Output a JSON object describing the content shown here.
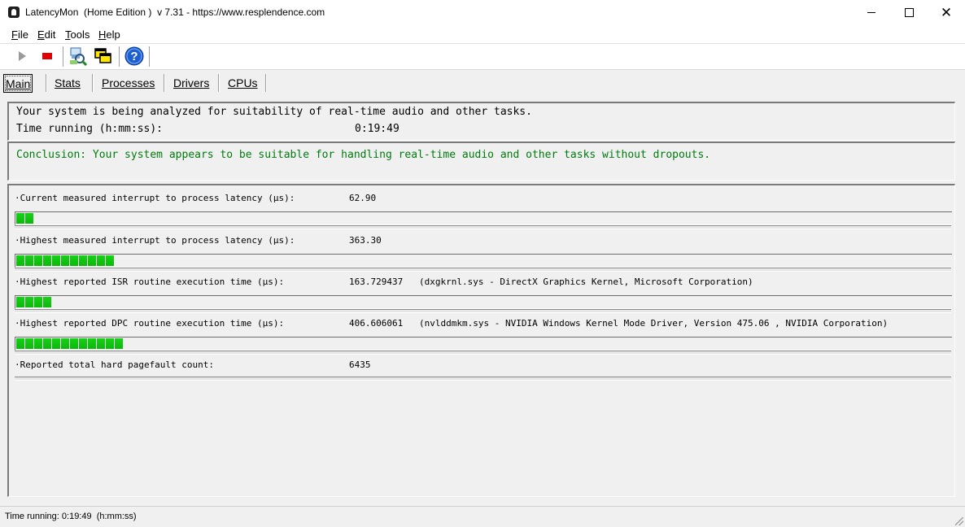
{
  "window": {
    "title": "LatencyMon  (Home Edition )  v 7.31 - https://www.resplendence.com"
  },
  "menu": {
    "items": [
      {
        "key": "F",
        "rest": "ile"
      },
      {
        "key": "E",
        "rest": "dit"
      },
      {
        "key": "T",
        "rest": "ools"
      },
      {
        "key": "H",
        "rest": "elp"
      }
    ]
  },
  "toolbar": {
    "icons": [
      "play-icon",
      "stop-icon",
      "analyze-icon",
      "windows-icon",
      "help-icon"
    ],
    "colors": {
      "play": "#9a9a9a",
      "stop": "#e00000",
      "help": "#1e5fd0"
    }
  },
  "tabs": [
    {
      "label": "Main",
      "active": true
    },
    {
      "label": "Stats",
      "active": false
    },
    {
      "label": "Processes",
      "active": false
    },
    {
      "label": "Drivers",
      "active": false
    },
    {
      "label": "CPUs",
      "active": false
    }
  ],
  "analysis": {
    "line1": "Your system is being analyzed for suitability of real-time audio and other tasks.",
    "time_label": "Time running (h:mm:ss):",
    "time_value": "0:19:49"
  },
  "conclusion": {
    "text": "Conclusion: Your system appears to be suitable for handling real-time audio and other tasks without dropouts.",
    "color": "#007a0e"
  },
  "metrics": [
    {
      "label": "·Current measured interrupt to process latency (µs):",
      "value": "62.90",
      "detail": "",
      "meter_fraction": 0.021
    },
    {
      "label": "·Highest measured interrupt to process latency (µs):",
      "value": "363.30",
      "detail": "",
      "meter_fraction": 0.103
    },
    {
      "label": "·Highest reported ISR routine execution time (µs):",
      "value": "163.729437",
      "detail": "(dxgkrnl.sys - DirectX Graphics Kernel, Microsoft Corporation)",
      "meter_fraction": 0.041
    },
    {
      "label": "·Highest reported DPC routine execution time (µs):",
      "value": "406.606061",
      "detail": "(nvlddmkm.sys - NVIDIA Windows Kernel Mode Driver, Version 475.06 , NVIDIA Corporation)",
      "meter_fraction": 0.114
    },
    {
      "label": "·Reported total hard pagefault count:",
      "value": "6435",
      "detail": ""
    }
  ],
  "statusbar": {
    "text": "Time running: 0:19:49  (h:mm:ss)"
  }
}
